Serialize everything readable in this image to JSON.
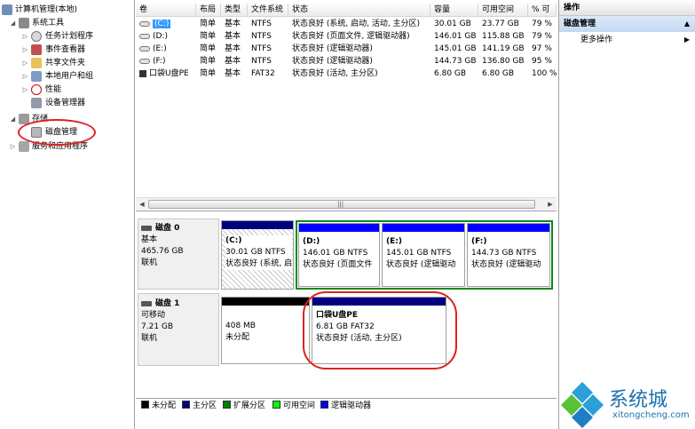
{
  "tree": {
    "root": "计算机管理(本地)",
    "system_tools": "系统工具",
    "task_scheduler": "任务计划程序",
    "event_viewer": "事件查看器",
    "shared_folders": "共享文件夹",
    "local_users": "本地用户和组",
    "performance": "性能",
    "device_manager": "设备管理器",
    "storage": "存储",
    "disk_management": "磁盘管理",
    "services_apps": "服务和应用程序"
  },
  "table": {
    "headers": [
      "卷",
      "布局",
      "类型",
      "文件系统",
      "状态",
      "容量",
      "可用空间",
      "% 可"
    ],
    "rows": [
      [
        "(C:)",
        "简单",
        "基本",
        "NTFS",
        "状态良好 (系统, 启动, 活动, 主分区)",
        "30.01 GB",
        "23.77 GB",
        "79 %"
      ],
      [
        "(D:)",
        "简单",
        "基本",
        "NTFS",
        "状态良好 (页面文件, 逻辑驱动器)",
        "146.01 GB",
        "115.88 GB",
        "79 %"
      ],
      [
        "(E:)",
        "简单",
        "基本",
        "NTFS",
        "状态良好 (逻辑驱动器)",
        "145.01 GB",
        "141.19 GB",
        "97 %"
      ],
      [
        "(F:)",
        "简单",
        "基本",
        "NTFS",
        "状态良好 (逻辑驱动器)",
        "144.73 GB",
        "136.80 GB",
        "95 %"
      ],
      [
        "口袋U盘PE",
        "简单",
        "基本",
        "FAT32",
        "状态良好 (活动, 主分区)",
        "6.80 GB",
        "6.80 GB",
        "100 %"
      ]
    ],
    "scroll_grip": "|||"
  },
  "disks": [
    {
      "name": "磁盘 0",
      "type": "基本",
      "size": "465.76 GB",
      "status": "联机",
      "partitions": [
        {
          "name": "(C:)",
          "size": "30.01 GB NTFS",
          "status": "状态良好 (系统, 启"
        },
        {
          "name": "(D:)",
          "size": "146.01 GB NTFS",
          "status": "状态良好 (页面文件"
        },
        {
          "name": "(E:)",
          "size": "145.01 GB NTFS",
          "status": "状态良好 (逻辑驱动"
        },
        {
          "name": "(F:)",
          "size": "144.73 GB NTFS",
          "status": "状态良好 (逻辑驱动"
        }
      ]
    },
    {
      "name": "磁盘 1",
      "type": "可移动",
      "size": "7.21 GB",
      "status": "联机",
      "partitions": [
        {
          "name": "",
          "size": "408 MB",
          "status": "未分配"
        },
        {
          "name": "口袋U盘PE",
          "size": "6.81 GB FAT32",
          "status": "状态良好 (活动, 主分区)"
        }
      ]
    }
  ],
  "legend": [
    {
      "label": "未分配",
      "color": "#000000"
    },
    {
      "label": "主分区",
      "color": "#00007f"
    },
    {
      "label": "扩展分区",
      "color": "#007f00"
    },
    {
      "label": "可用空间",
      "color": "#00ff00"
    },
    {
      "label": "逻辑驱动器",
      "color": "#0000ff"
    }
  ],
  "actions": {
    "title": "操作",
    "section": "磁盘管理",
    "more": "更多操作"
  },
  "colors": {
    "primary": "#00007f",
    "logical": "#0000ff",
    "extended": "#007f00",
    "unallocated": "#000000",
    "annotation": "#e02020"
  },
  "watermark": {
    "brand": "系统城",
    "url": "xitongcheng.com"
  },
  "icons": [
    "computer-icon",
    "tools-icon",
    "clock-icon",
    "event-icon",
    "share-icon",
    "users-icon",
    "perf-icon",
    "device-icon",
    "storage-icon",
    "disk-icon",
    "services-icon",
    "drive-icon",
    "usb-icon",
    "hdd-icon"
  ]
}
